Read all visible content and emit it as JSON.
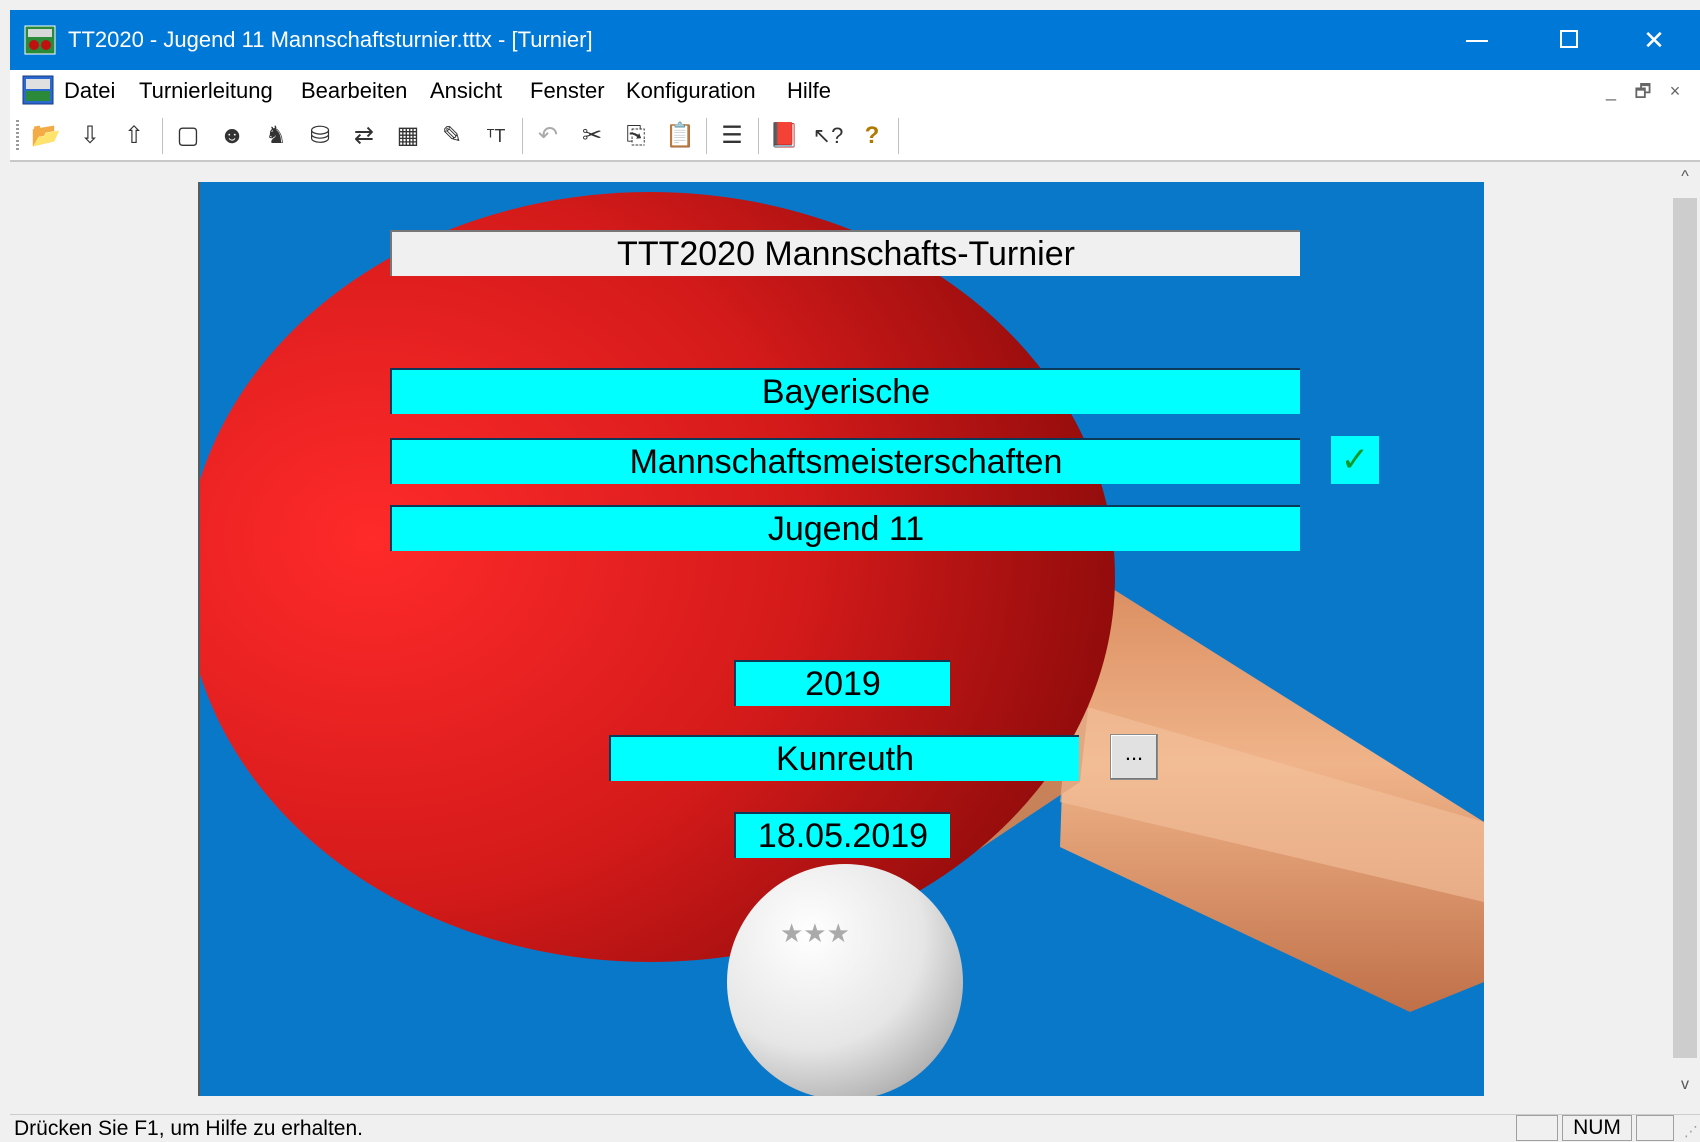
{
  "window": {
    "title": "TT2020 - Jugend 11 Mannschaftsturnier.tttx - [Turnier]",
    "controls": {
      "minimize": "—",
      "maximize": "☐",
      "close": "✕"
    }
  },
  "menu": {
    "items": [
      "Datei",
      "Turnierleitung",
      "Bearbeiten",
      "Ansicht",
      "Fenster",
      "Konfiguration",
      "Hilfe"
    ],
    "mdi_controls": {
      "minimize": "_",
      "restore": "🗗",
      "close": "×"
    }
  },
  "toolbar": {
    "buttons": [
      {
        "icon": "open-folder-icon",
        "glyph": "📂"
      },
      {
        "icon": "import-icon",
        "glyph": "⇩"
      },
      {
        "icon": "export-icon",
        "glyph": "⇧"
      },
      {
        "icon": "window-icon",
        "glyph": "▢"
      },
      {
        "icon": "player-icon",
        "glyph": "☻"
      },
      {
        "icon": "team-icon",
        "glyph": "♞"
      },
      {
        "icon": "database-icon",
        "glyph": "⛁"
      },
      {
        "icon": "transfer-icon",
        "glyph": "⇄"
      },
      {
        "icon": "plan-icon",
        "glyph": "▦"
      },
      {
        "icon": "edit-icon",
        "glyph": "✎"
      },
      {
        "icon": "font-size-icon",
        "glyph": "ᵀT"
      },
      {
        "icon": "undo-icon",
        "glyph": "↶"
      },
      {
        "icon": "cut-icon",
        "glyph": "✂"
      },
      {
        "icon": "copy-icon",
        "glyph": "⎘"
      },
      {
        "icon": "paste-icon",
        "glyph": "📋"
      },
      {
        "icon": "list-icon",
        "glyph": "☰"
      },
      {
        "icon": "book-icon",
        "glyph": "📕"
      },
      {
        "icon": "context-help-icon",
        "glyph": "↖?"
      },
      {
        "icon": "help-icon",
        "glyph": "?"
      }
    ]
  },
  "tournament": {
    "heading": "TTT2020 Mannschafts-Turnier",
    "line1": "Bayerische",
    "line2": "Mannschaftsmeisterschaften",
    "line2_check": "✓",
    "line3": "Jugend 11",
    "year": "2019",
    "location": "Kunreuth",
    "location_button": "...",
    "date": "18.05.2019"
  },
  "status": {
    "text": "Drücken Sie F1, um Hilfe zu erhalten.",
    "indicator_num": "NUM"
  },
  "colors": {
    "titlebar": "#0078d7",
    "poster_bg": "#0a78c8",
    "field_bg": "#00ffff",
    "paddle_red": "#c81818",
    "handle": "#e4a67a",
    "check_green": "#0a9a28"
  }
}
